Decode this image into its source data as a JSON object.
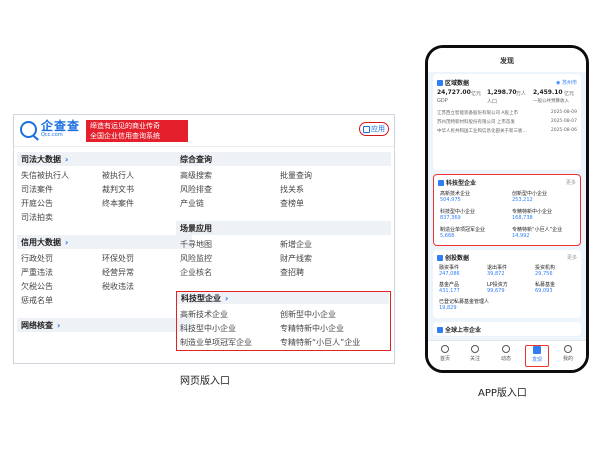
{
  "web": {
    "logo_name": "企查查",
    "logo_domain": "Qcc.com",
    "slogan_line1": "缔造有远见的商业传奇",
    "slogan_line2": "全国企业信用查询系统",
    "app_button_label": "应用",
    "sections": {
      "judicial": {
        "title": "司法大数据",
        "links": [
          "失信被执行人",
          "被执行人",
          "司法案件",
          "裁判文书",
          "开庭公告",
          "终本案件",
          "司法拍卖"
        ]
      },
      "credit": {
        "title": "信用大数据",
        "links": [
          "行政处罚",
          "环保处罚",
          "严重违法",
          "经营异常",
          "欠税公告",
          "税收违法",
          "惩戒名单"
        ]
      },
      "network": {
        "title": "网络核查"
      },
      "comprehensive": {
        "title": "综合查询",
        "links": [
          "高级搜索",
          "批量查询",
          "风险排查",
          "找关系",
          "产业链",
          "查榜单"
        ]
      },
      "scenario": {
        "title": "场景应用",
        "links": [
          "千寻地图",
          "新增企业",
          "风险监控",
          "财产线索",
          "企业核名",
          "查招聘"
        ]
      },
      "tech": {
        "title": "科技型企业",
        "links": [
          "高新技术企业",
          "创新型中小企业",
          "科技型中小企业",
          "专精特新中小企业",
          "制造业单项冠军企业",
          "专精特新“小巨人”企业"
        ]
      }
    }
  },
  "captions": {
    "web": "网页版入口",
    "app": "APP版入口"
  },
  "app": {
    "title": "发现",
    "region": {
      "title": "区域数据",
      "city": "苏州市",
      "stats": [
        {
          "value": "24,727.00",
          "unit": "亿元",
          "label": "GDP"
        },
        {
          "value": "1,298.70",
          "unit": "万人",
          "label": "人口"
        },
        {
          "value": "2,459.10",
          "unit": "亿元",
          "label": "一般公共预算收入"
        }
      ],
      "news": [
        {
          "text": "江苏西立智能装备股份有限公司 A股上市",
          "date": "2025-08-09"
        },
        {
          "text": "苏州茂特新材料股份有限公司 上市首发",
          "date": "2025-08-07"
        },
        {
          "text": "中华人民共和国工业和信息化部关于新三板…",
          "date": "2025-08-06"
        }
      ]
    },
    "tech": {
      "title": "科技型企业",
      "more": "更多",
      "items": [
        {
          "label": "高新技术企业",
          "value": "504,975"
        },
        {
          "label": "创新型中小企业",
          "value": "253,212"
        },
        {
          "label": "科技型中小企业",
          "value": "837,369"
        },
        {
          "label": "专精特新中小企业",
          "value": "168,738"
        },
        {
          "label": "制造业单项冠军企业",
          "value": "5,668"
        },
        {
          "label": "专精特新“小巨人”企业",
          "value": "14,992"
        }
      ]
    },
    "venture": {
      "title": "创投数据",
      "more": "更多",
      "items": [
        {
          "label": "融资事件",
          "value": "247,086"
        },
        {
          "label": "退出事件",
          "value": "39,872"
        },
        {
          "label": "投资机构",
          "value": "29,756"
        },
        {
          "label": "基金产品",
          "value": "431,177"
        },
        {
          "label": "LP投资方",
          "value": "99,679"
        },
        {
          "label": "私募基金",
          "value": "69,093"
        },
        {
          "label": "已登记私募基金管理人",
          "value": "19,829"
        }
      ]
    },
    "listed": {
      "title": "全球上市企业"
    },
    "tabs": [
      {
        "label": "首页"
      },
      {
        "label": "关注"
      },
      {
        "label": "动态"
      },
      {
        "label": "发现"
      },
      {
        "label": "我的"
      }
    ]
  }
}
